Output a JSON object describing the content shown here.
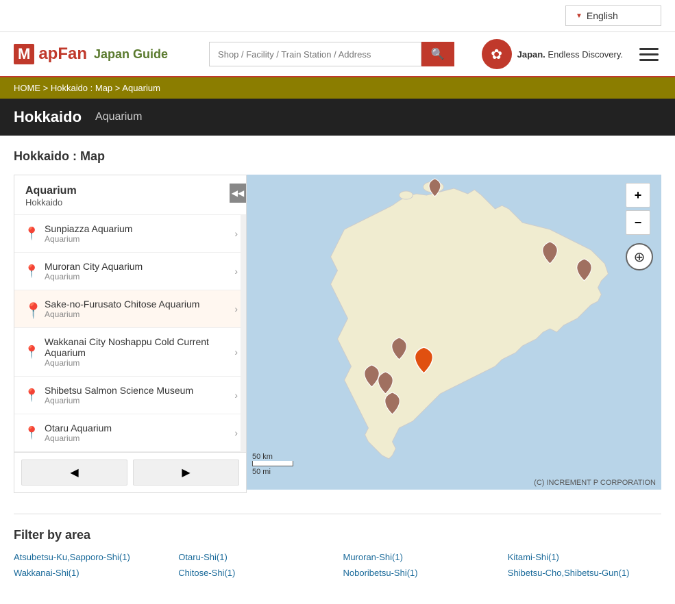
{
  "langBar": {
    "language": "English",
    "arrowSymbol": "▼"
  },
  "header": {
    "logoM": "M",
    "logoText": "apFan",
    "logoSub": "Japan Guide",
    "searchPlaceholder": "Shop / Facility / Train Station / Address",
    "searchIcon": "🔍",
    "japanBrand": "Japan.",
    "japanTagline": "Endless Discovery.",
    "menuIcon": "☰"
  },
  "breadcrumb": {
    "items": [
      "HOME",
      "Hokkaido : Map",
      "Aquarium"
    ],
    "separator": ">"
  },
  "pageTitleBar": {
    "region": "Hokkaido",
    "category": "Aquarium"
  },
  "sectionTitle": "Hokkaido : Map",
  "sidebar": {
    "heading": "Aquarium",
    "subheading": "Hokkaido",
    "collapseSymbol": "◀◀",
    "items": [
      {
        "name": "Sunpiazza Aquarium",
        "type": "Aquarium",
        "active": false
      },
      {
        "name": "Muroran City Aquarium",
        "type": "Aquarium",
        "active": false
      },
      {
        "name": "Sake-no-Furusato Chitose Aquarium",
        "type": "Aquarium",
        "active": true
      },
      {
        "name": "Wakkanai City Noshappu Cold Current Aquarium",
        "type": "Aquarium",
        "active": false
      },
      {
        "name": "Shibetsu Salmon Science Museum",
        "type": "Aquarium",
        "active": false
      },
      {
        "name": "Otaru Aquarium",
        "type": "Aquarium",
        "active": false
      }
    ],
    "prevLabel": "◀",
    "nextLabel": "▶"
  },
  "map": {
    "copyright": "(C) INCREMENT P CORPORATION",
    "scale50km": "50 km",
    "scale50mi": "50 mi",
    "zoomIn": "+",
    "zoomOut": "−",
    "compassSymbol": "⊕"
  },
  "filterSection": {
    "title": "Filter by area",
    "areas": [
      "Atsubetsu-Ku,Sapporo-Shi(1)",
      "Otaru-Shi(1)",
      "Muroran-Shi(1)",
      "Kitami-Shi(1)",
      "Wakkanai-Shi(1)",
      "Chitose-Shi(1)",
      "Noboribetsu-Shi(1)",
      "Shibetsu-Cho,Shibetsu-Gun(1)"
    ]
  }
}
